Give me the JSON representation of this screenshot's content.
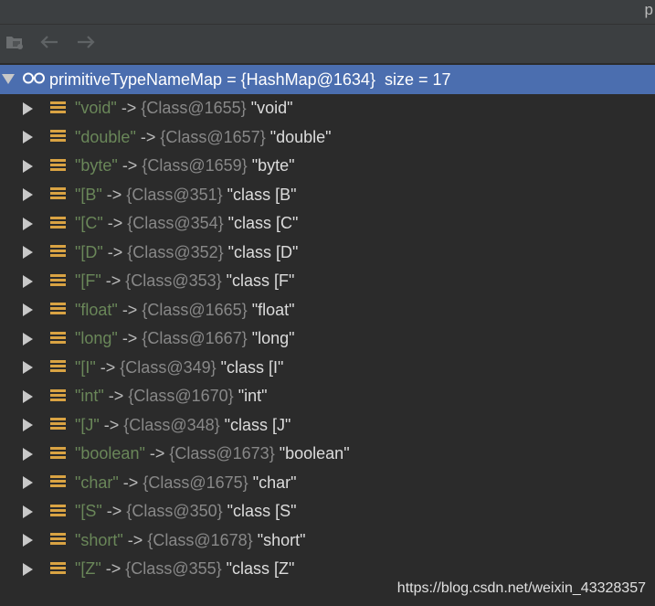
{
  "topbar": {
    "corner_text": "p"
  },
  "root": {
    "name": "primitiveTypeNameMap",
    "equals": " = ",
    "ref": "{HashMap@1634}",
    "size": "size = 17"
  },
  "entries": [
    {
      "key": "\"void\"",
      "arrow": " -> ",
      "ref": "{Class@1655}",
      "value": "\"void\""
    },
    {
      "key": "\"double\"",
      "arrow": " -> ",
      "ref": "{Class@1657}",
      "value": "\"double\""
    },
    {
      "key": "\"byte\"",
      "arrow": " -> ",
      "ref": "{Class@1659}",
      "value": "\"byte\""
    },
    {
      "key": "\"[B\"",
      "arrow": " -> ",
      "ref": "{Class@351}",
      "value": "\"class [B\""
    },
    {
      "key": "\"[C\"",
      "arrow": " -> ",
      "ref": "{Class@354}",
      "value": "\"class [C\""
    },
    {
      "key": "\"[D\"",
      "arrow": " -> ",
      "ref": "{Class@352}",
      "value": "\"class [D\""
    },
    {
      "key": "\"[F\"",
      "arrow": " -> ",
      "ref": "{Class@353}",
      "value": "\"class [F\""
    },
    {
      "key": "\"float\"",
      "arrow": " -> ",
      "ref": "{Class@1665}",
      "value": "\"float\""
    },
    {
      "key": "\"long\"",
      "arrow": " -> ",
      "ref": "{Class@1667}",
      "value": "\"long\""
    },
    {
      "key": "\"[I\"",
      "arrow": " -> ",
      "ref": "{Class@349}",
      "value": "\"class [I\""
    },
    {
      "key": "\"int\"",
      "arrow": " -> ",
      "ref": "{Class@1670}",
      "value": "\"int\""
    },
    {
      "key": "\"[J\"",
      "arrow": " -> ",
      "ref": "{Class@348}",
      "value": "\"class [J\""
    },
    {
      "key": "\"boolean\"",
      "arrow": " -> ",
      "ref": "{Class@1673}",
      "value": "\"boolean\""
    },
    {
      "key": "\"char\"",
      "arrow": " -> ",
      "ref": "{Class@1675}",
      "value": "\"char\""
    },
    {
      "key": "\"[S\"",
      "arrow": " -> ",
      "ref": "{Class@350}",
      "value": "\"class [S\""
    },
    {
      "key": "\"short\"",
      "arrow": " -> ",
      "ref": "{Class@1678}",
      "value": "\"short\""
    },
    {
      "key": "\"[Z\"",
      "arrow": " -> ",
      "ref": "{Class@355}",
      "value": "\"class [Z\""
    }
  ],
  "icons": {
    "toolbar": [
      "restore-layout-icon",
      "back-arrow-icon",
      "forward-arrow-icon"
    ],
    "root": [
      "expanded-arrow-icon",
      "watch-glasses-icon"
    ],
    "entry": [
      "collapsed-arrow-icon",
      "map-entry-icon"
    ]
  },
  "colors": {
    "background": "#2b2b2b",
    "toolbar": "#3c3f41",
    "selection": "#4b6eaf",
    "string_key": "#6a8759",
    "entry_icon": "#d9a343"
  },
  "watermark": "https://blog.csdn.net/weixin_43328357"
}
